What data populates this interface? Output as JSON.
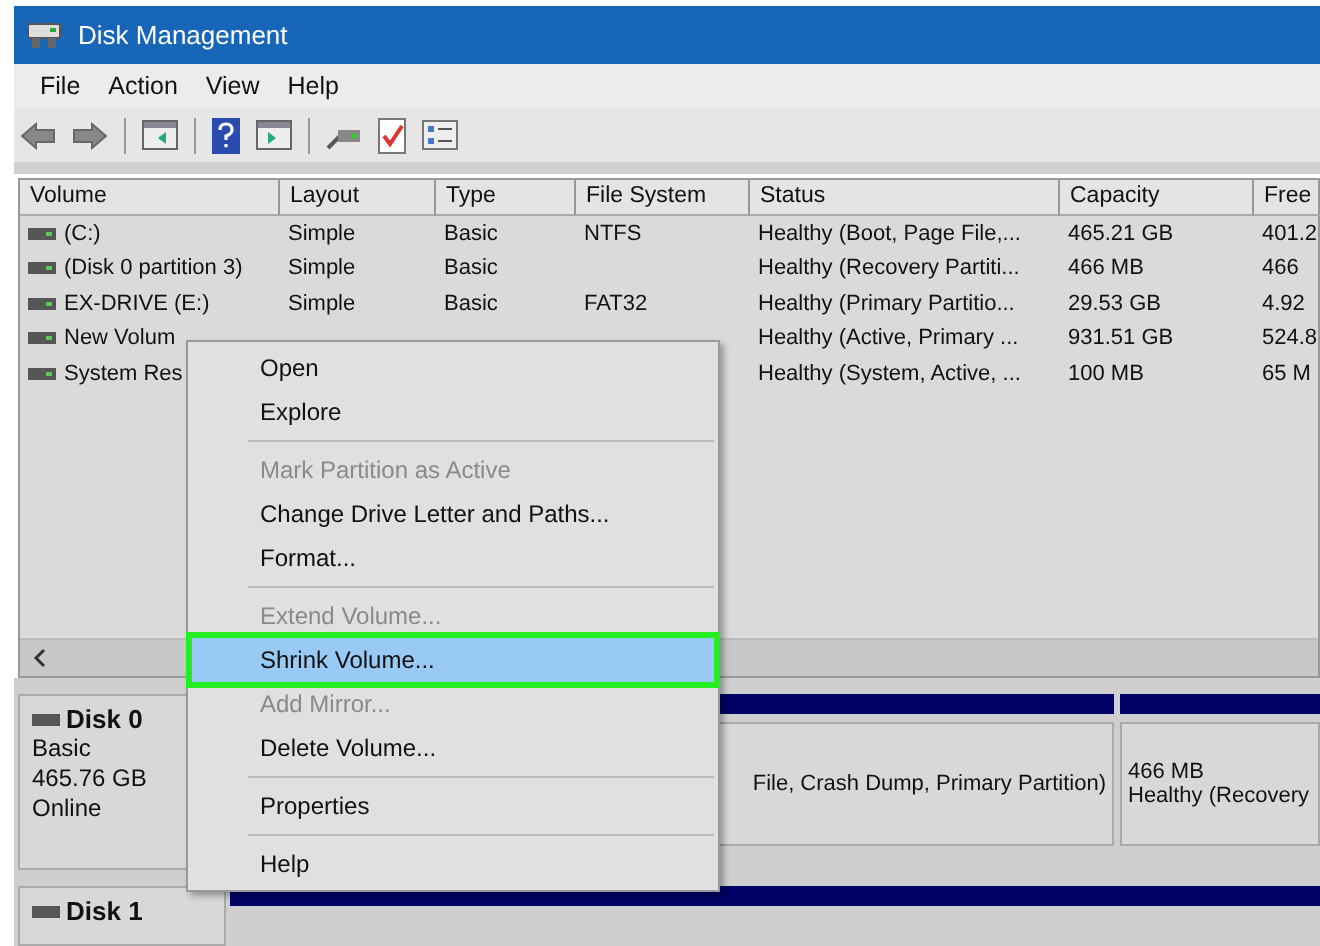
{
  "window": {
    "title": "Disk Management"
  },
  "menu_bar": [
    "File",
    "Action",
    "View",
    "Help"
  ],
  "volume_table": {
    "columns": [
      "Volume",
      "Layout",
      "Type",
      "File System",
      "Status",
      "Capacity",
      "Free"
    ],
    "rows": [
      {
        "cells": [
          "(C:)",
          "Simple",
          "Basic",
          "NTFS",
          "Healthy (Boot, Page File,...",
          "465.21 GB",
          "401.2"
        ]
      },
      {
        "cells": [
          "(Disk 0 partition 3)",
          "Simple",
          "Basic",
          null,
          "Healthy (Recovery Partiti...",
          "466 MB",
          "466"
        ]
      },
      {
        "cells": [
          "EX-DRIVE (E:)",
          "Simple",
          "Basic",
          "FAT32",
          "Healthy (Primary Partitio...",
          "29.53 GB",
          "4.92"
        ]
      },
      {
        "cells": [
          "New Volum",
          null,
          null,
          null,
          "Healthy (Active, Primary ...",
          "931.51 GB",
          "524.8"
        ]
      },
      {
        "cells": [
          "System Res",
          null,
          null,
          null,
          "Healthy (System, Active, ...",
          "100 MB",
          "65 M"
        ]
      }
    ]
  },
  "disks": [
    {
      "name": "Disk 0",
      "details": [
        "Basic",
        "465.76 GB",
        "Online"
      ],
      "partitions": [
        {
          "lines": [
            "File, Crash Dump, Primary Partition)"
          ]
        },
        {
          "lines": [
            "466 MB",
            "Healthy (Recovery"
          ]
        }
      ]
    },
    {
      "name": "Disk 1"
    }
  ],
  "context_menu": [
    {
      "kind": "item",
      "label": "Open",
      "disabled": false,
      "selected": false
    },
    {
      "kind": "item",
      "label": "Explore",
      "disabled": false,
      "selected": false
    },
    {
      "kind": "separator"
    },
    {
      "kind": "item",
      "label": "Mark Partition as Active",
      "disabled": true,
      "selected": false
    },
    {
      "kind": "item",
      "label": "Change Drive Letter and Paths...",
      "disabled": false,
      "selected": false
    },
    {
      "kind": "item",
      "label": "Format...",
      "disabled": false,
      "selected": false
    },
    {
      "kind": "separator"
    },
    {
      "kind": "item",
      "label": "Extend Volume...",
      "disabled": true,
      "selected": false
    },
    {
      "kind": "item",
      "label": "Shrink Volume...",
      "disabled": false,
      "selected": true
    },
    {
      "kind": "item",
      "label": "Add Mirror...",
      "disabled": true,
      "selected": false
    },
    {
      "kind": "item",
      "label": "Delete Volume...",
      "disabled": false,
      "selected": false
    },
    {
      "kind": "separator"
    },
    {
      "kind": "item",
      "label": "Properties",
      "disabled": false,
      "selected": false
    },
    {
      "kind": "separator"
    },
    {
      "kind": "item",
      "label": "Help",
      "disabled": false,
      "selected": false
    }
  ]
}
